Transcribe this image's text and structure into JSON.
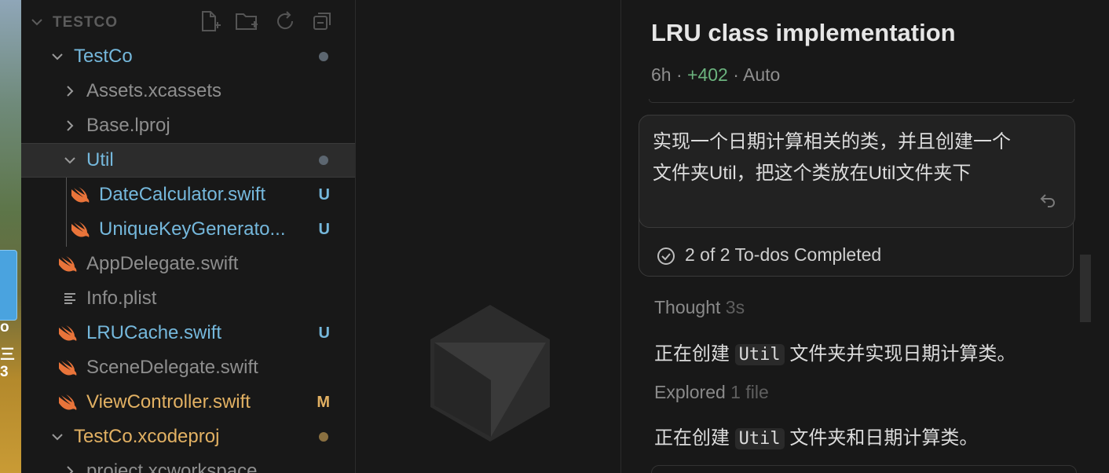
{
  "explorer": {
    "section_title": "TESTCO",
    "rows": [
      {
        "label": "TestCo",
        "badge": ""
      },
      {
        "label": "Assets.xcassets",
        "badge": ""
      },
      {
        "label": "Base.lproj",
        "badge": ""
      },
      {
        "label": "Util",
        "badge": ""
      },
      {
        "label": "DateCalculator.swift",
        "badge": "U"
      },
      {
        "label": "UniqueKeyGenerato...",
        "badge": "U"
      },
      {
        "label": "AppDelegate.swift",
        "badge": ""
      },
      {
        "label": "Info.plist",
        "badge": ""
      },
      {
        "label": "LRUCache.swift",
        "badge": "U"
      },
      {
        "label": "SceneDelegate.swift",
        "badge": ""
      },
      {
        "label": "ViewController.swift",
        "badge": "M"
      },
      {
        "label": "TestCo.xcodeproj",
        "badge": ""
      },
      {
        "label": "project.xcworkspace",
        "badge": ""
      }
    ]
  },
  "chat": {
    "title": "LRU class implementation",
    "meta_time": "6h",
    "meta_sep": "·",
    "meta_additions": "+402",
    "meta_mode": "· Auto",
    "user_message": "实现一个日期计算相关的类，并且创建一个文件夹Util，把这个类放在Util文件夹下",
    "todos": "2 of 2 To-dos Completed",
    "thought_label": "Thought",
    "thought_time": "3s",
    "line1_before": "正在创建",
    "line1_code": "Util",
    "line1_after": "文件夹并实现日期计算类。",
    "explored_label": "Explored",
    "explored_count": "1 file",
    "line2_before": "正在创建",
    "line2_code": "Util",
    "line2_after": "文件夹和日期计算类。"
  },
  "desktop": {
    "text_a": "o",
    "text_b": "三 3"
  },
  "colors": {
    "accent_blue": "#75b8dc",
    "modified_orange": "#e2b163",
    "additions_green": "#6bb37e"
  }
}
